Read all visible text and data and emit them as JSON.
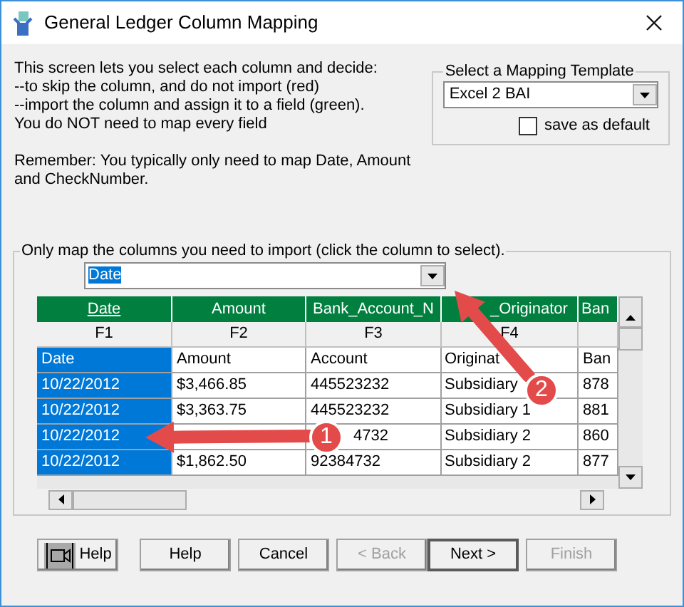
{
  "window": {
    "title": "General Ledger Column Mapping"
  },
  "intro": [
    "This screen lets you select each column and decide:",
    "--to skip the column, and do not import (red)",
    "--import the column and assign it to a field (green).",
    "You do NOT need to map every field"
  ],
  "reminder": [
    "Remember:  You typically only need to map Date, Amount",
    "and CheckNumber."
  ],
  "template": {
    "legend": "Select a Mapping Template",
    "value": "Excel 2 BAI",
    "save_default": {
      "label": "save as default",
      "checked": false
    }
  },
  "mapping": {
    "legend": "Only map the columns you need to import (click the column to select).",
    "field_value": "Date",
    "columns": [
      {
        "mapping": "Date",
        "field": "F1",
        "selected": true
      },
      {
        "mapping": "Amount",
        "field": "F2",
        "selected": false
      },
      {
        "mapping": "Bank_Account_N",
        "field": "F3",
        "selected": false
      },
      {
        "mapping": "_Originator",
        "field": "F4",
        "selected": false
      },
      {
        "mapping": "Ban",
        "selected": false
      }
    ],
    "rows": [
      [
        "Date",
        "Amount",
        "Account",
        "Originat",
        "Ban"
      ],
      [
        "10/22/2012",
        "$3,466.85",
        "445523232",
        "Subsidiary",
        "878"
      ],
      [
        "10/22/2012",
        "$3,363.75",
        "445523232",
        "Subsidiary 1",
        "881"
      ],
      [
        "10/22/2012",
        null,
        "4732",
        "Subsidiary 2",
        "860"
      ],
      [
        "10/22/2012",
        "$1,862.50",
        "92384732",
        "Subsidiary 2",
        "877"
      ]
    ]
  },
  "callouts": [
    {
      "number": "1"
    },
    {
      "number": "2"
    }
  ],
  "buttons": [
    {
      "kind": "icon",
      "label": "Help",
      "disabled": false,
      "default": false
    },
    {
      "kind": "text",
      "label": "Help",
      "disabled": false,
      "default": false
    },
    {
      "kind": "text",
      "label": "Cancel",
      "disabled": false,
      "default": false
    },
    {
      "kind": "text",
      "label": "< Back",
      "disabled": true,
      "default": false
    },
    {
      "kind": "text",
      "label": "Next >",
      "disabled": false,
      "default": true
    },
    {
      "kind": "text",
      "label": "Finish",
      "disabled": true,
      "default": false
    }
  ]
}
